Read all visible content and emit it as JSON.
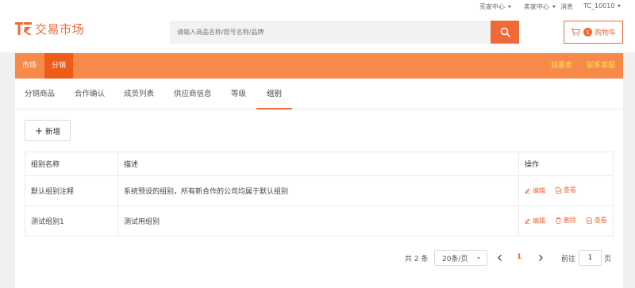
{
  "topbar": {
    "buyer_center": "买家中心",
    "seller_center": "卖家中心",
    "messages": "消息",
    "user": "TC_10010"
  },
  "header": {
    "logo_text": "交易市场",
    "search_placeholder": "请输入商品名称/款号名称/品牌",
    "cart_count": "1",
    "cart_label": "购物车"
  },
  "nav": {
    "items": [
      "市场",
      "分销"
    ],
    "active": "分销",
    "right": [
      "我要卖",
      "联系客服"
    ]
  },
  "tabs": {
    "items": [
      "分销商品",
      "合作确认",
      "成员列表",
      "供应商信息",
      "等级",
      "组别"
    ],
    "active": "组别"
  },
  "toolbar": {
    "add_label": "新增"
  },
  "table": {
    "columns": [
      "组别名称",
      "描述",
      "操作"
    ],
    "rows": [
      {
        "name": "默认组别注释",
        "desc": "系统预设的组别，所有新合作的公司均属于默认组别",
        "actions": [
          "编辑",
          "查看"
        ]
      },
      {
        "name": "测试组别1",
        "desc": "测试用组别",
        "actions": [
          "编辑",
          "删除",
          "查看"
        ]
      }
    ]
  },
  "pagination": {
    "total": "共 2 条",
    "page_size": "20条/页",
    "current_page": "1",
    "goto_prefix": "前往",
    "goto_value": "1",
    "goto_suffix": "页"
  },
  "colors": {
    "accent": "#f06a37",
    "nav_bg": "#f78a4b",
    "nav_active": "#ef5c1a",
    "nav_right_text": "#ffe34d"
  }
}
